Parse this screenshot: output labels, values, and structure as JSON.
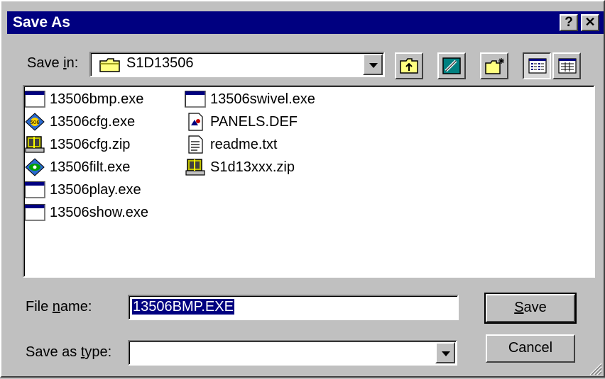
{
  "window": {
    "title": "Save As",
    "help_glyph": "?",
    "close_glyph": "✕"
  },
  "save_in": {
    "label_pre": "Save ",
    "label_key": "i",
    "label_post": "n:",
    "folder": "S1D13506"
  },
  "toolbar": {
    "icons": [
      "up-one-level-icon",
      "desktop-icon",
      "new-folder-icon",
      "list-view-icon",
      "details-view-icon"
    ]
  },
  "files": {
    "column1": [
      {
        "name": "13506bmp.exe",
        "icon": "app-window-icon"
      },
      {
        "name": "13506cfg.exe",
        "icon": "cfg-app-icon"
      },
      {
        "name": "13506cfg.zip",
        "icon": "zip-archive-icon"
      },
      {
        "name": "13506filt.exe",
        "icon": "filt-app-icon"
      },
      {
        "name": "13506play.exe",
        "icon": "app-window-icon"
      },
      {
        "name": "13506show.exe",
        "icon": "app-window-icon"
      }
    ],
    "column2": [
      {
        "name": "13506swivel.exe",
        "icon": "app-window-icon"
      },
      {
        "name": "PANELS.DEF",
        "icon": "def-file-icon"
      },
      {
        "name": "readme.txt",
        "icon": "text-file-icon"
      },
      {
        "name": "S1d13xxx.zip",
        "icon": "zip-archive-icon"
      }
    ]
  },
  "file_name": {
    "label_pre": "File ",
    "label_key": "n",
    "label_post": "ame:",
    "value": "13506BMP.EXE"
  },
  "save_as_type": {
    "label_pre": "Save as ",
    "label_key": "t",
    "label_post": "ype:",
    "value": ""
  },
  "buttons": {
    "save_key": "S",
    "save_rest": "ave",
    "cancel": "Cancel"
  }
}
